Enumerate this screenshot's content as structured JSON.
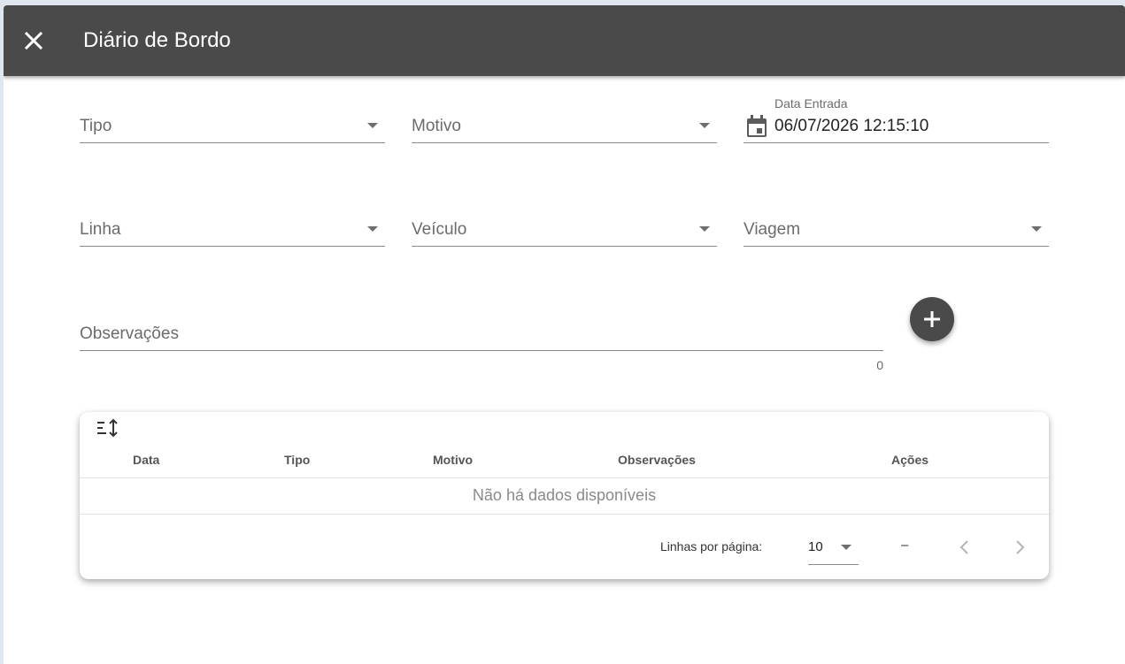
{
  "dialog": {
    "title": "Diário de Bordo"
  },
  "form": {
    "tipo": {
      "label": "Tipo"
    },
    "motivo": {
      "label": "Motivo"
    },
    "data_entrada": {
      "label": "Data Entrada",
      "value": "06/07/2026 12:15:10"
    },
    "linha": {
      "label": "Linha"
    },
    "veiculo": {
      "label": "Veículo"
    },
    "viagem": {
      "label": "Viagem"
    },
    "observacoes": {
      "label": "Observações",
      "counter": "0"
    }
  },
  "table": {
    "headers": [
      "Data",
      "Tipo",
      "Motivo",
      "Observações",
      "Ações"
    ],
    "empty_text": "Não há dados disponíveis",
    "rows_per_page_label": "Linhas por página:",
    "rows_per_page_value": "10",
    "range_text": "–"
  },
  "colors": {
    "toolbar": "#4a4a4a",
    "fab": "#4a4a4a"
  }
}
